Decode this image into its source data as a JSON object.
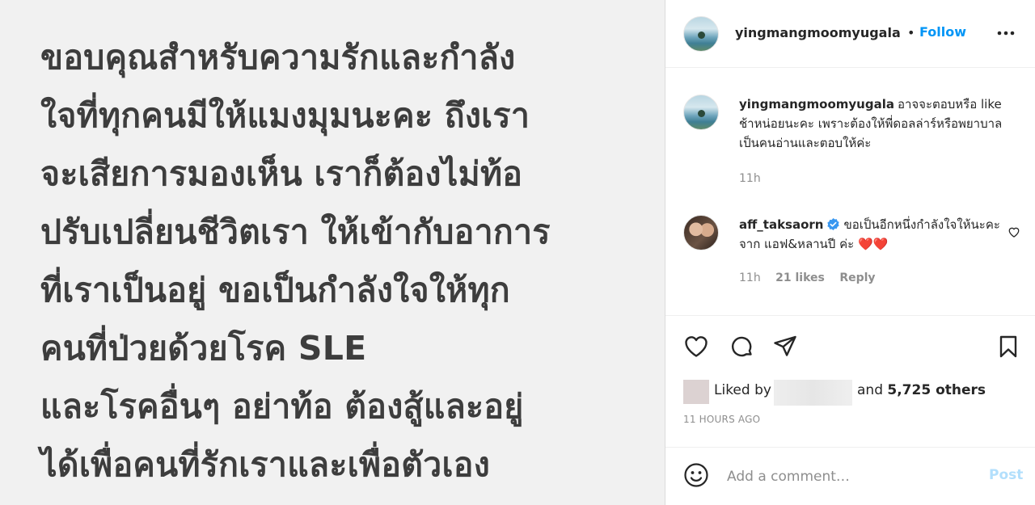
{
  "post": {
    "lines": [
      "ขอบคุณสำหรับความรักและกำลัง",
      "ใจที่ทุกคนมีให้แมงมุมนะคะ ถึงเรา",
      "จะเสียการมองเห็น เราก็ต้องไม่ท้อ",
      "ปรับเปลี่ยนชีวิตเรา ให้เข้ากับอาการ",
      "ที่เราเป็นอยู่ ขอเป็นกำลังใจให้ทุก",
      "คนที่ป่วยด้วยโรค SLE",
      "และโรคอื่นๆ อย่าท้อ ต้องสู้และอยู่",
      "ได้เพื่อคนที่รักเราและเพื่อตัวเอง"
    ]
  },
  "header": {
    "username": "yingmangmoomyugala",
    "dot": "•",
    "follow_label": "Follow"
  },
  "comments": [
    {
      "username": "yingmangmoomyugala",
      "text": "อาจจะตอบหรือ like ช้าหน่อยนะคะ เพราะต้องให้พี่ดอลล่าร์หรือพยาบาลเป็นคนอ่านและตอบให้ค่ะ",
      "time": "11h"
    },
    {
      "username": "aff_taksaorn",
      "text": "ขอเป็นอีกหนึ่งกำลังใจให้นะคะ จาก แอฟ&หลานปี ค่ะ ❤️❤️",
      "time": "11h",
      "likes": "21 likes",
      "reply_label": "Reply"
    }
  ],
  "likes": {
    "liked_by_label": "Liked by",
    "and_label": "and",
    "others": "5,725 others"
  },
  "post_time": "11 HOURS AGO",
  "composer": {
    "placeholder": "Add a comment…",
    "post_label": "Post"
  },
  "colors": {
    "link_blue": "#0095f6",
    "post_disabled": "#b2dffc",
    "heart_red": "#ed4956",
    "verified_blue": "#3897f0"
  }
}
